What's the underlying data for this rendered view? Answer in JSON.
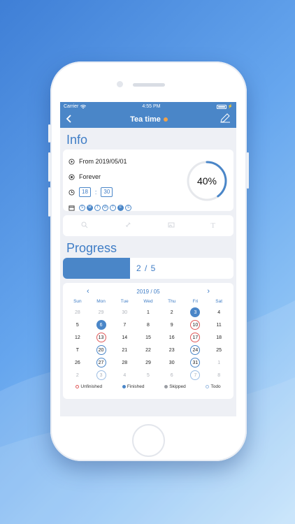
{
  "status": {
    "carrier": "Carrier",
    "time": "4:55 PM"
  },
  "nav": {
    "back_icon": "chevron-left-icon",
    "title": "Tea time",
    "edit_icon": "pencil-icon"
  },
  "info": {
    "section_title": "Info",
    "start": "From 2019/05/01",
    "repeat": "Forever",
    "hour": "18",
    "minute": "30",
    "time_sep": ":",
    "weekdays": [
      "S",
      "M",
      "T",
      "W",
      "T",
      "F",
      "S"
    ],
    "weekdays_selected": [
      1,
      5
    ],
    "percent_label": "40%",
    "percent_value": 0.4
  },
  "tools": [
    "search-icon",
    "link-icon",
    "image-icon",
    "text-icon"
  ],
  "progress": {
    "section_title": "Progress",
    "label": "2 / 5",
    "fraction": 0.4
  },
  "calendar": {
    "month_label": "2019 / 05",
    "days_of_week": [
      "Sun",
      "Mon",
      "Tue",
      "Wed",
      "Thu",
      "Fri",
      "Sat"
    ],
    "weeks": [
      [
        {
          "d": "28",
          "m": true
        },
        {
          "d": "29",
          "m": true
        },
        {
          "d": "30",
          "m": true
        },
        {
          "d": "1"
        },
        {
          "d": "2"
        },
        {
          "d": "3",
          "s": "finished"
        },
        {
          "d": "4"
        }
      ],
      [
        {
          "d": "5"
        },
        {
          "d": "6",
          "s": "finished"
        },
        {
          "d": "7"
        },
        {
          "d": "8"
        },
        {
          "d": "9"
        },
        {
          "d": "10",
          "s": "unfinished"
        },
        {
          "d": "11"
        }
      ],
      [
        {
          "d": "12"
        },
        {
          "d": "13",
          "s": "unfinished"
        },
        {
          "d": "14"
        },
        {
          "d": "15"
        },
        {
          "d": "16"
        },
        {
          "d": "17",
          "s": "unfinished"
        },
        {
          "d": "18"
        }
      ],
      [
        {
          "d": "T"
        },
        {
          "d": "20",
          "s": "todo"
        },
        {
          "d": "21"
        },
        {
          "d": "22"
        },
        {
          "d": "23"
        },
        {
          "d": "24",
          "s": "todo"
        },
        {
          "d": "25"
        }
      ],
      [
        {
          "d": "26"
        },
        {
          "d": "27",
          "s": "todo"
        },
        {
          "d": "28"
        },
        {
          "d": "29"
        },
        {
          "d": "30"
        },
        {
          "d": "31",
          "s": "todo"
        },
        {
          "d": "1",
          "m": true
        }
      ],
      [
        {
          "d": "2",
          "m": true
        },
        {
          "d": "3",
          "m": true,
          "s": "todo"
        },
        {
          "d": "4",
          "m": true
        },
        {
          "d": "5",
          "m": true
        },
        {
          "d": "6",
          "m": true
        },
        {
          "d": "7",
          "m": true,
          "s": "todo"
        },
        {
          "d": "8",
          "m": true
        }
      ]
    ],
    "legend": [
      {
        "label": "Unfinished",
        "color": "#e05a5a",
        "style": "ring"
      },
      {
        "label": "Finished",
        "color": "#4a86c8",
        "style": "fill"
      },
      {
        "label": "Skipped",
        "color": "#9a9da3",
        "style": "fill"
      },
      {
        "label": "Todo",
        "color": "#9cbde3",
        "style": "ring"
      }
    ]
  },
  "colors": {
    "accent": "#4a86c8",
    "unfinished": "#e05a5a",
    "dot": "#f0a24a"
  }
}
